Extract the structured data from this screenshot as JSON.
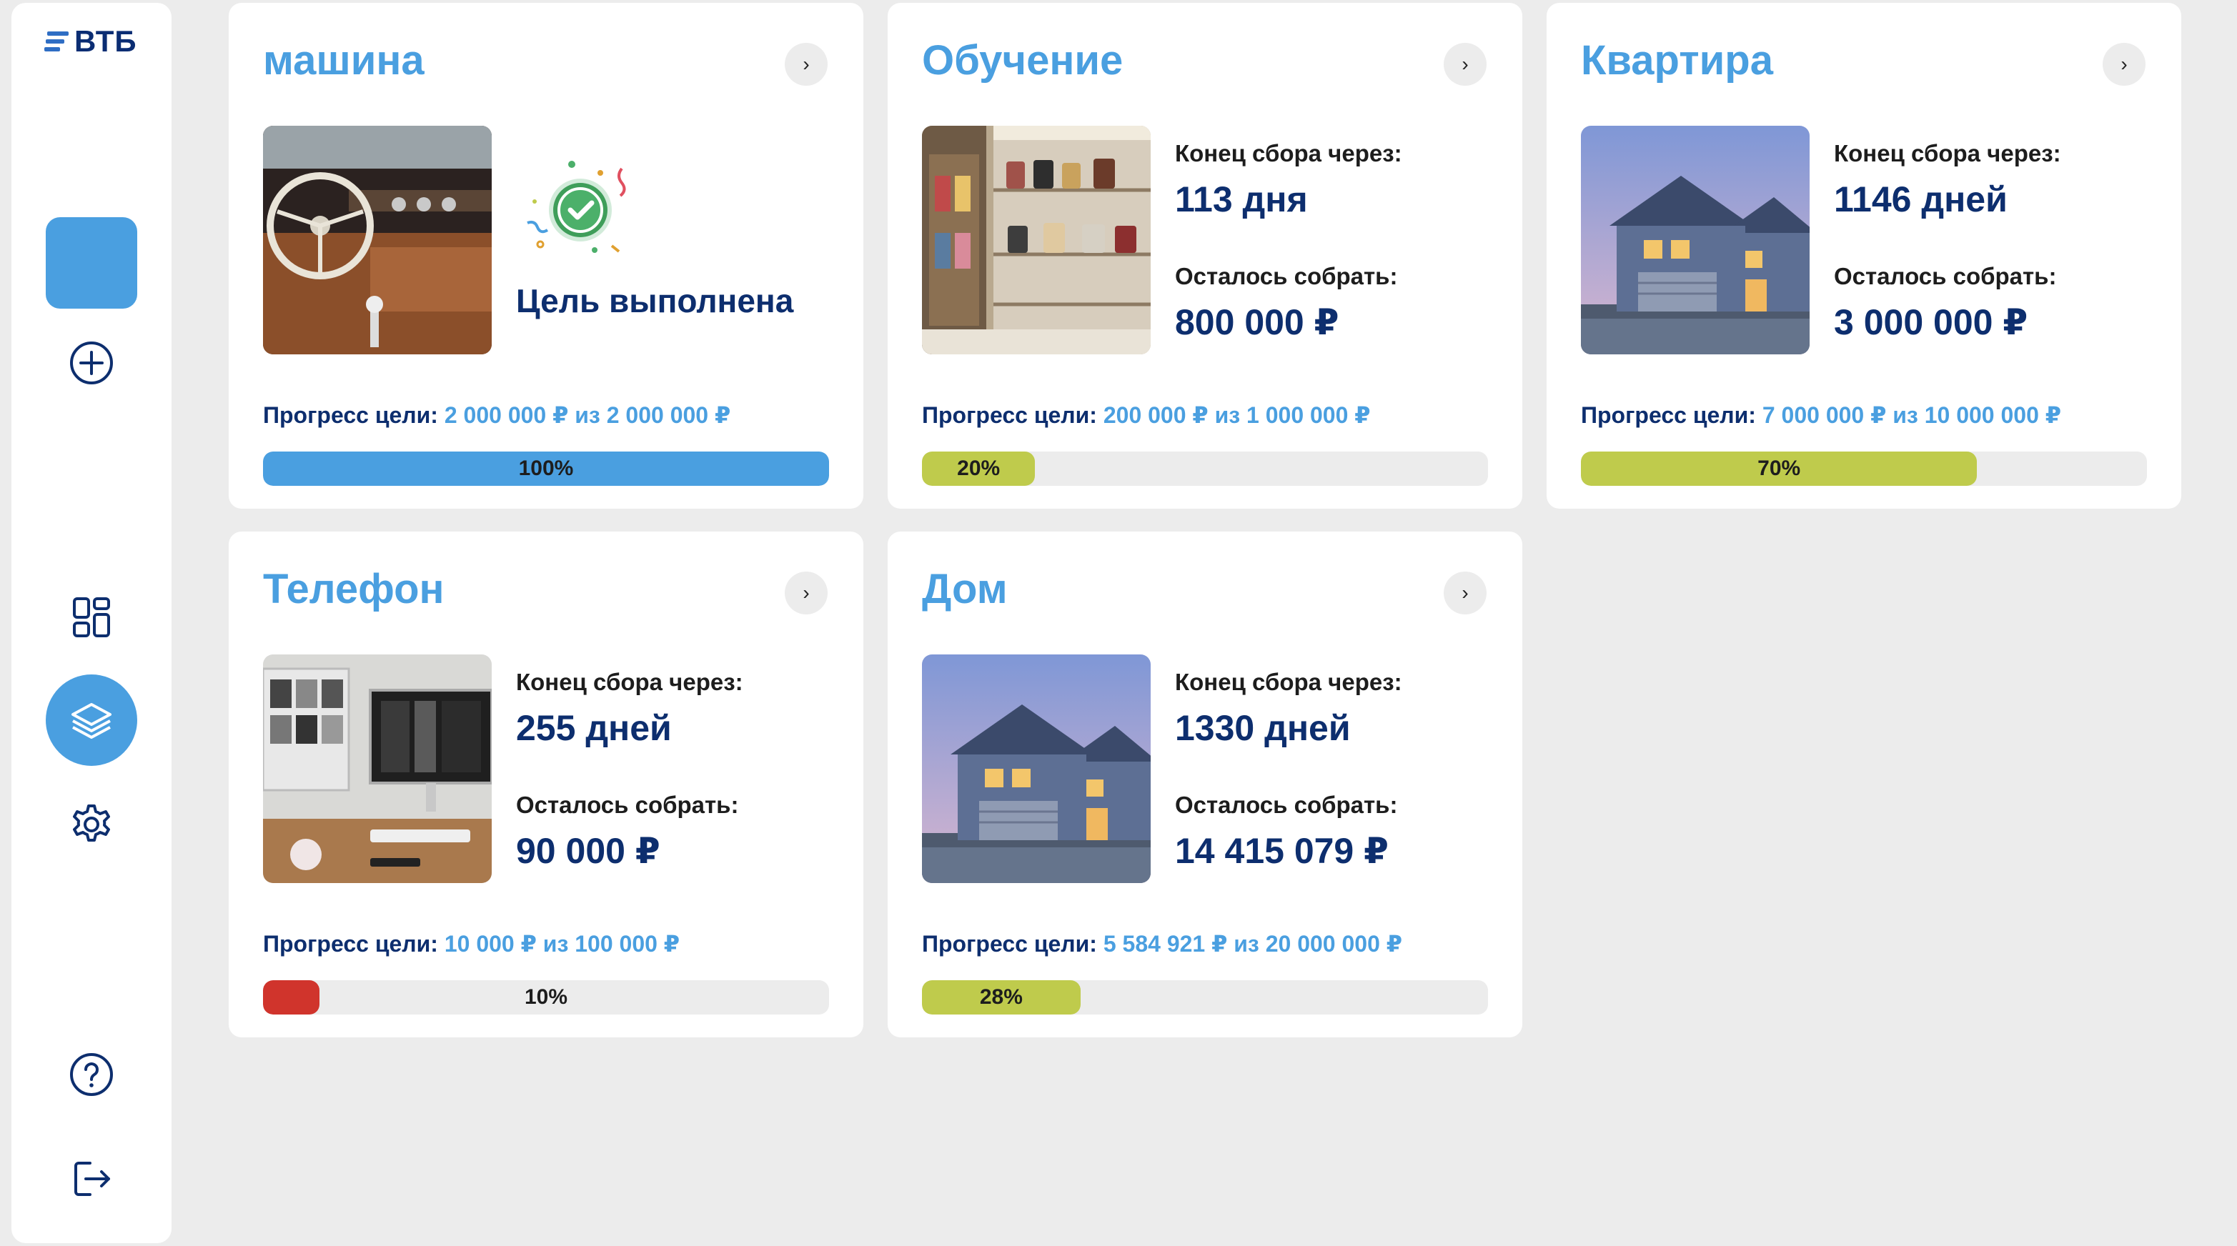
{
  "brand": {
    "name": "ВТБ"
  },
  "goals": [
    {
      "title": "машина",
      "completed": true,
      "status_text": "Цель выполнена",
      "progress_label": "Прогресс цели:",
      "progress_value": "2 000 000 ₽ из 2 000 000 ₽",
      "percent": 1.0,
      "percent_text": "100%",
      "bar_color": "#4a9fe0",
      "image": "car-interior"
    },
    {
      "title": "Обучение",
      "completed": false,
      "end_label": "Конец сбора через:",
      "end_value": "113 дня",
      "remaining_label": "Осталось собрать:",
      "remaining_value": "800 000 ₽",
      "progress_label": "Прогресс цели:",
      "progress_value": "200 000 ₽ из 1 000 000 ₽",
      "percent": 0.2,
      "percent_text": "20%",
      "bar_color": "#bfcb4c",
      "image": "boutique-shelves"
    },
    {
      "title": "Квартира",
      "completed": false,
      "end_label": "Конец сбора через:",
      "end_value": "1146 дней",
      "remaining_label": "Осталось собрать:",
      "remaining_value": "3 000 000 ₽",
      "progress_label": "Прогресс цели:",
      "progress_value": "7 000 000 ₽ из 10 000 000 ₽",
      "percent": 0.7,
      "percent_text": "70%",
      "bar_color": "#bfcb4c",
      "image": "house"
    },
    {
      "title": "Телефон",
      "completed": false,
      "end_label": "Конец сбора через:",
      "end_value": "255 дней",
      "remaining_label": "Осталось собрать:",
      "remaining_value": "90 000 ₽",
      "progress_label": "Прогресс цели:",
      "progress_value": "10 000 ₽ из 100 000 ₽",
      "percent": 0.1,
      "percent_text": "10%",
      "bar_color": "#d0342c",
      "image": "computer-desk"
    },
    {
      "title": "Дом",
      "completed": false,
      "end_label": "Конец сбора через:",
      "end_value": "1330 дней",
      "remaining_label": "Осталось собрать:",
      "remaining_value": "14 415 079 ₽",
      "progress_label": "Прогресс цели:",
      "progress_value": "5 584 921 ₽ из 20 000 000 ₽",
      "percent": 0.28,
      "percent_text": "28%",
      "bar_color": "#bfcb4c",
      "image": "house"
    }
  ],
  "icons": {
    "add": "plus-circle-icon",
    "dashboard": "dashboard-icon",
    "goals": "layers-icon",
    "settings": "gear-icon",
    "help": "help-icon",
    "logout": "logout-icon",
    "chevron": "chevron-right-icon"
  },
  "colors": {
    "accent": "#4a9fe0",
    "navy": "#0d2e6e",
    "background": "#ececec",
    "progress_green": "#bfcb4c",
    "progress_red": "#d0342c"
  }
}
